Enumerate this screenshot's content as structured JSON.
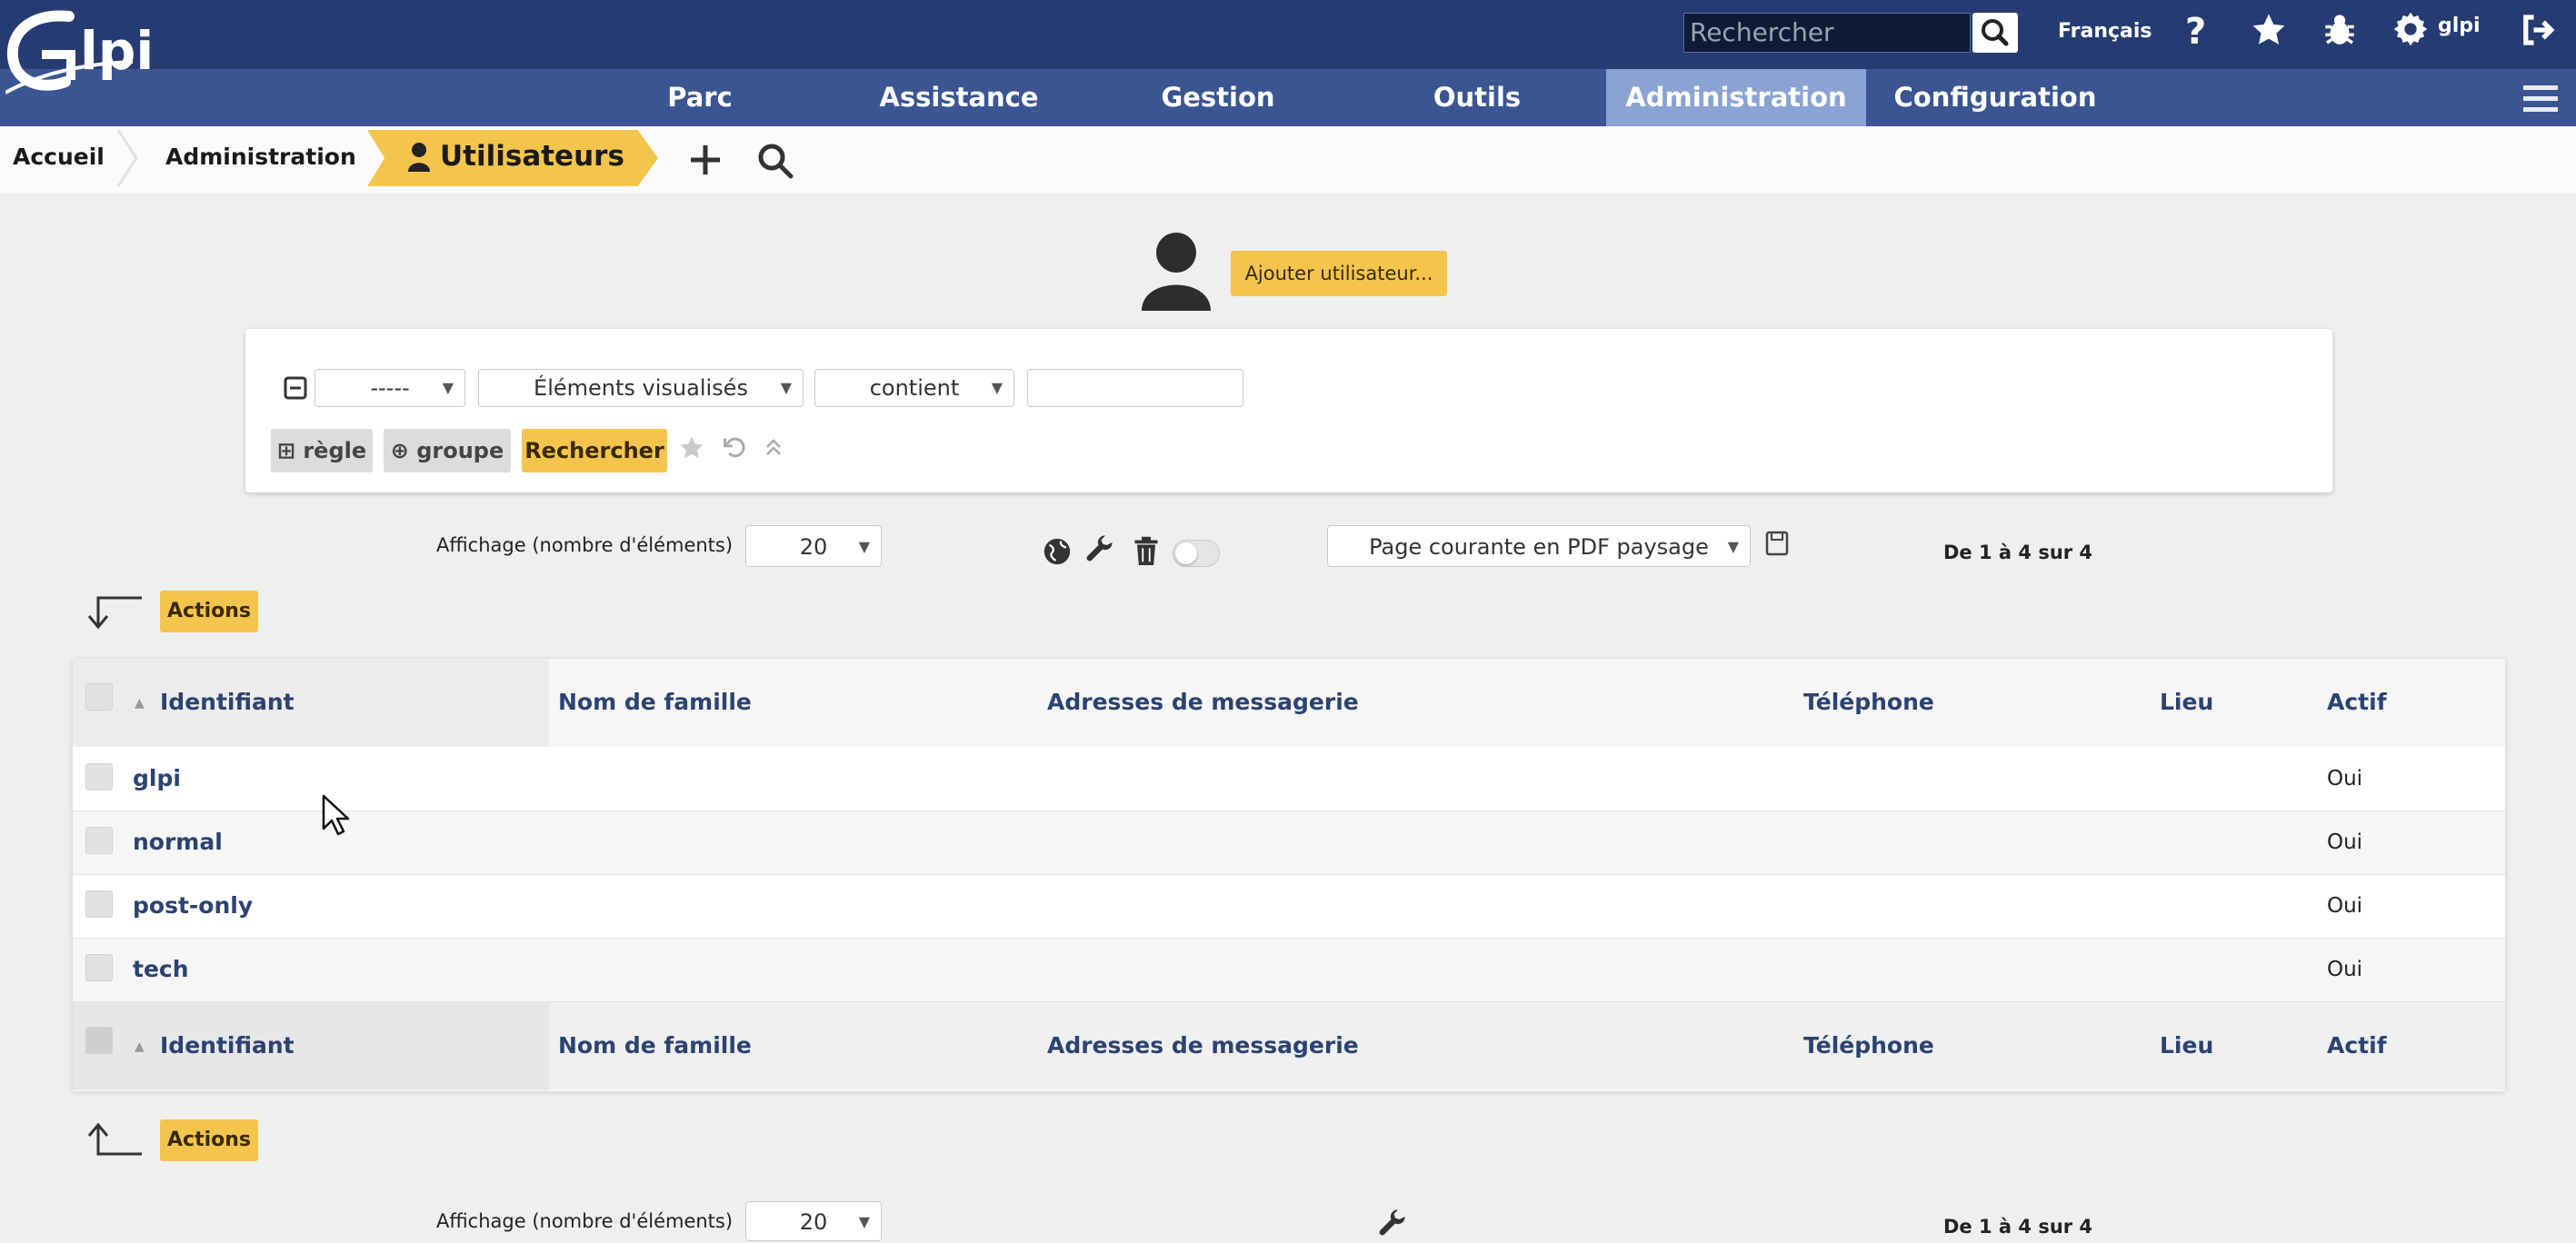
{
  "app": {
    "logo_text": "Glpi"
  },
  "top": {
    "search_placeholder": "Rechercher",
    "language": "Français",
    "user": "glpi"
  },
  "menu": [
    {
      "label": "Parc"
    },
    {
      "label": "Assistance"
    },
    {
      "label": "Gestion"
    },
    {
      "label": "Outils"
    },
    {
      "label": "Administration"
    },
    {
      "label": "Configuration"
    }
  ],
  "breadcrumb": {
    "home": "Accueil",
    "section": "Administration",
    "current": "Utilisateurs"
  },
  "add_user_button": "Ajouter utilisateur...",
  "search_form": {
    "criteria_field": "-----",
    "criteria_type": "Éléments visualisés",
    "operator": "contient",
    "value": "",
    "rule_button": "règle",
    "group_button": "groupe",
    "search_button": "Rechercher"
  },
  "display": {
    "label": "Affichage (nombre d'éléments)",
    "count": "20",
    "export_option": "Page courante en PDF paysage",
    "pagination": "De 1 à 4 sur 4"
  },
  "actions_label": "Actions",
  "table": {
    "headers": [
      "Identifiant",
      "Nom de famille",
      "Adresses de messagerie",
      "Téléphone",
      "Lieu",
      "Actif"
    ],
    "rows": [
      {
        "login": "glpi",
        "active": "Oui"
      },
      {
        "login": "normal",
        "active": "Oui"
      },
      {
        "login": "post-only",
        "active": "Oui"
      },
      {
        "login": "tech",
        "active": "Oui"
      }
    ]
  },
  "colors": {
    "header": "#253b72",
    "menu": "#3b5592",
    "active_menu": "#8aa3d3",
    "accent": "#f4c54c"
  }
}
